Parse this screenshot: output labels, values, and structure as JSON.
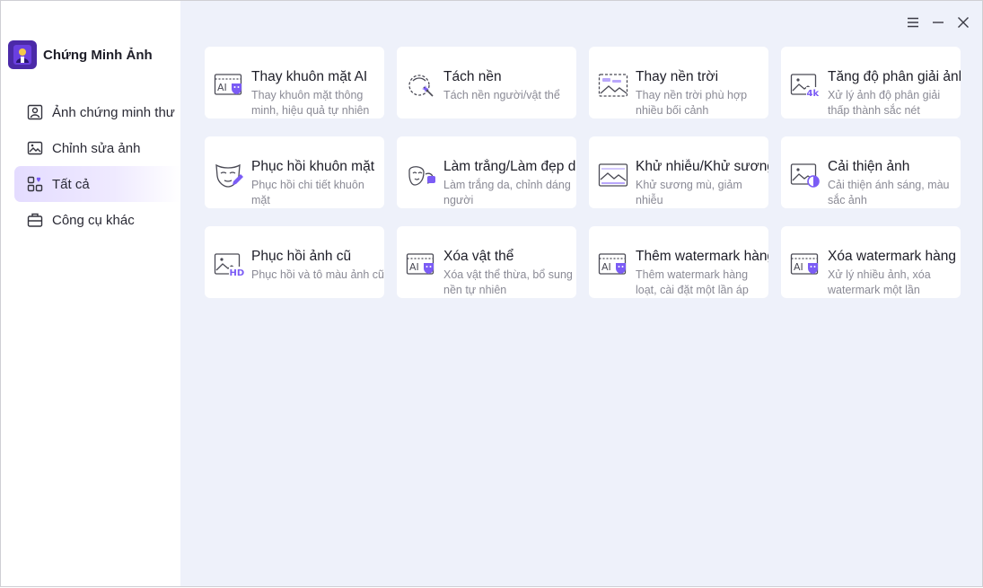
{
  "app": {
    "title": "Chứng Minh Ảnh"
  },
  "colors": {
    "accent": "#7b5cf5",
    "brand": "#4b2aa8",
    "active_bg": "#e4dcff",
    "content_bg": "#eef1fa"
  },
  "window_controls": [
    "menu-icon",
    "minimize-icon",
    "close-icon"
  ],
  "sidebar": {
    "items": [
      {
        "label": "Ảnh chứng minh thư",
        "icon": "id-photo-icon",
        "active": false
      },
      {
        "label": "Chỉnh sửa ảnh",
        "icon": "image-edit-icon",
        "active": false
      },
      {
        "label": "Tất cả",
        "icon": "all-apps-icon",
        "active": true
      },
      {
        "label": "Công cụ khác",
        "icon": "toolbox-icon",
        "active": false
      }
    ]
  },
  "tools": [
    {
      "title": "Thay khuôn mặt AI",
      "desc": "Thay khuôn mặt thông minh, hiệu quả tự nhiên",
      "icon": "ai-face-icon"
    },
    {
      "title": "Tách nền",
      "desc": "Tách nền người/vật thể",
      "icon": "cutout-icon"
    },
    {
      "title": "Thay nền trời",
      "desc": "Thay nền trời phù hợp nhiều bối cảnh",
      "icon": "sky-replace-icon"
    },
    {
      "title": "Tăng độ phân giải ảnh",
      "desc": "Xử lý ảnh độ phân giải thấp thành sắc nét",
      "icon": "upscale-4k-icon"
    },
    {
      "title": "Phục hồi khuôn mặt",
      "desc": "Phục hồi chi tiết khuôn mặt",
      "icon": "face-restore-icon"
    },
    {
      "title": "Làm trắng/Làm đẹp da",
      "desc": "Làm trắng da, chỉnh dáng người",
      "icon": "beauty-icon"
    },
    {
      "title": "Khử nhiễu/Khử sương",
      "desc": "Khử sương mù, giảm nhiễu",
      "icon": "denoise-icon"
    },
    {
      "title": "Cải thiện ảnh",
      "desc": "Cải thiện ánh sáng, màu sắc ảnh",
      "icon": "enhance-icon"
    },
    {
      "title": "Phục hồi ảnh cũ",
      "desc": "Phục hồi và tô màu ảnh cũ",
      "icon": "old-photo-hd-icon"
    },
    {
      "title": "Xóa vật thể",
      "desc": "Xóa vật thể thừa, bổ sung nền tự nhiên",
      "icon": "ai-erase-icon"
    },
    {
      "title": "Thêm watermark hàng loạt",
      "desc": "Thêm watermark hàng loạt, cài đặt một lần áp",
      "icon": "ai-watermark-add-icon"
    },
    {
      "title": "Xóa watermark hàng loạt",
      "desc": "Xử lý nhiều ảnh, xóa watermark một lần",
      "icon": "ai-watermark-remove-icon"
    }
  ]
}
